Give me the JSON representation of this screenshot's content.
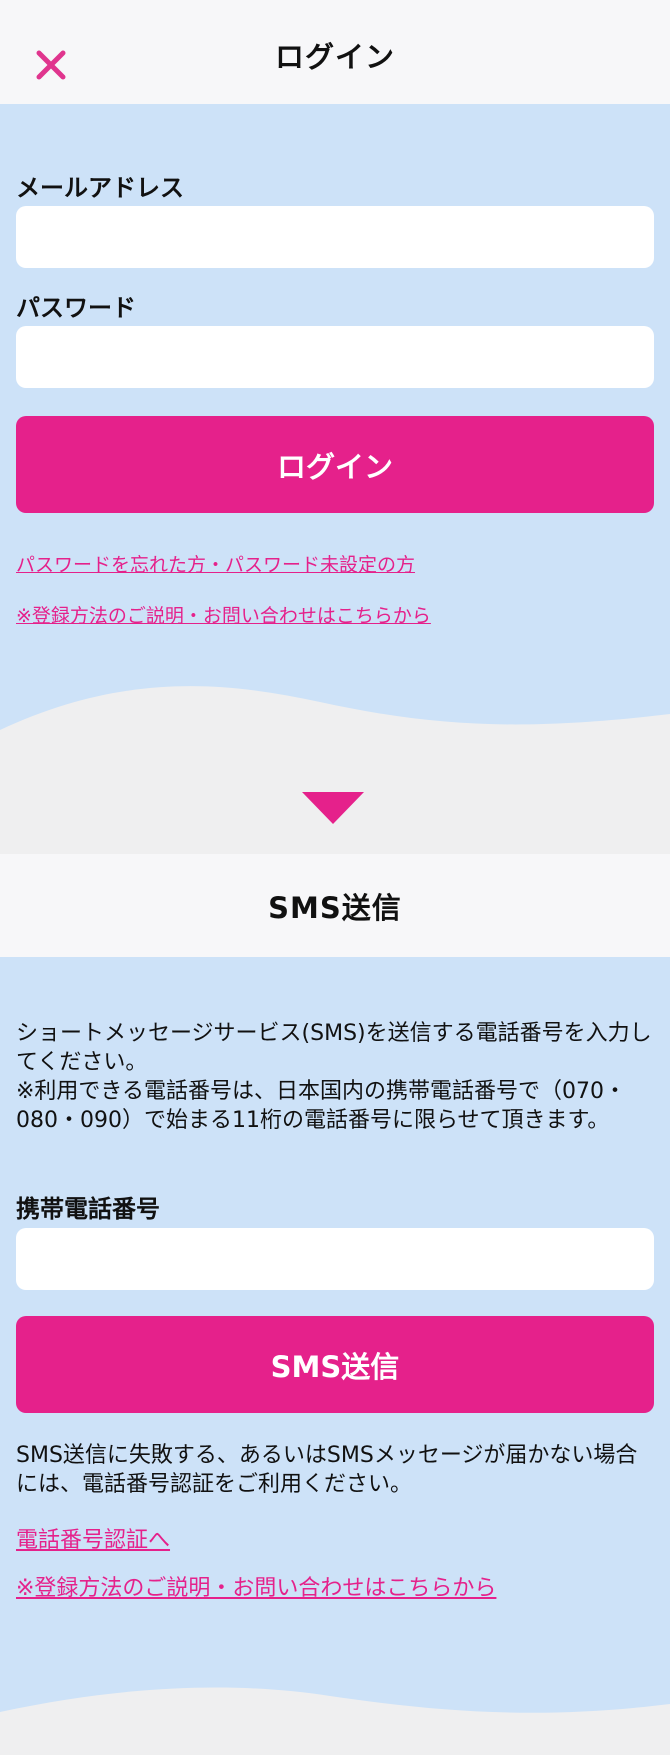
{
  "header": {
    "title": "ログイン",
    "close_icon": "close-icon"
  },
  "login": {
    "email_label": "メールアドレス",
    "email_value": "",
    "password_label": "パスワード",
    "password_value": "",
    "login_button": "ログイン",
    "forgot_link": "パスワードを忘れた方・パスワード未設定の方",
    "help_link": "※登録方法のご説明・お問い合わせはこちらから"
  },
  "sms_header": {
    "title": "SMS送信"
  },
  "sms": {
    "description": "ショートメッセージサービス(SMS)を送信する電話番号を入力してください。\n※利用できる電話番号は、日本国内の携帯電話番号で（070・080・090）で始まる11桁の電話番号に限らせて頂きます。",
    "phone_label": "携帯電話番号",
    "phone_value": "",
    "send_button": "SMS送信",
    "fail_text": "SMS送信に失敗する、あるいはSMSメッセージが届かない場合には、電話番号認証をご利用ください。",
    "phone_auth_link": "電話番号認証へ",
    "help_link": "※登録方法のご説明・お問い合わせはこちらから"
  },
  "colors": {
    "accent": "#e5218b",
    "panel": "#cde2f8",
    "header_bg": "#f7f7f9",
    "page_bg": "#efeff0"
  },
  "icons": {
    "down": "triangle-down-icon"
  }
}
